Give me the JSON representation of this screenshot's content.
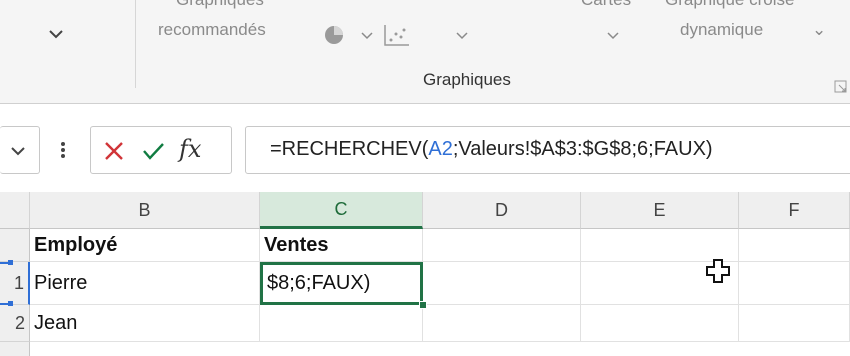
{
  "ribbon": {
    "top_left_truncated": "Graphiques",
    "recommended_label": "recommandés",
    "maps_truncated": "Cartes",
    "pivot_top_truncated": "Graphique croisé",
    "pivot_label": "dynamique",
    "group_label": "Graphiques"
  },
  "formula_bar": {
    "prefix": "=RECHERCHEV(",
    "ref": "A2",
    "suffix": ";Valeurs!$A$3:$G$8;6;FAUX)",
    "fx_label": "fx"
  },
  "columns": [
    "B",
    "C",
    "D",
    "E",
    "F"
  ],
  "rows": [
    {
      "num": "",
      "cells": [
        "Employé",
        "Ventes",
        "",
        "",
        ""
      ]
    },
    {
      "num": "1",
      "cells": [
        "Pierre",
        "$8;6;FAUX)",
        "",
        "",
        ""
      ]
    },
    {
      "num": "2",
      "cells": [
        "Jean",
        "",
        "",
        "",
        ""
      ]
    }
  ],
  "colors": {
    "accent_green": "#217346",
    "formula_ref_blue": "#2f6fd6",
    "cancel_red": "#d13438",
    "enter_green": "#107c41"
  }
}
